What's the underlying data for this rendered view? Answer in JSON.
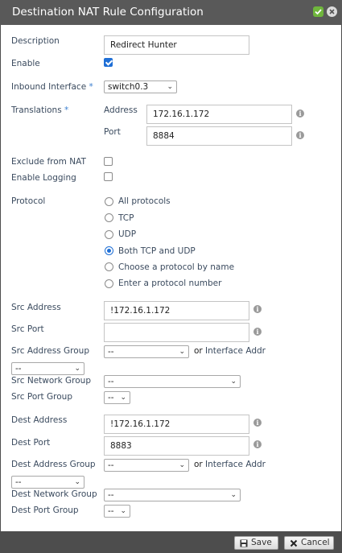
{
  "title": "Destination NAT Rule Configuration",
  "fields": {
    "description": {
      "label": "Description",
      "value": "Redirect Hunter"
    },
    "enable": {
      "label": "Enable",
      "checked": true
    },
    "inbound": {
      "label": "Inbound Interface",
      "required": "*",
      "value": "switch0.3"
    },
    "translations": {
      "label": "Translations",
      "required": "*",
      "address_label": "Address",
      "address_value": "172.16.1.172",
      "port_label": "Port",
      "port_value": "8884"
    },
    "exclude": {
      "label": "Exclude from NAT",
      "checked": false
    },
    "logging": {
      "label": "Enable Logging",
      "checked": false
    },
    "protocol": {
      "label": "Protocol",
      "options": [
        "All protocols",
        "TCP",
        "UDP",
        "Both TCP and UDP",
        "Choose a protocol by name",
        "Enter a protocol number"
      ],
      "selected": "Both TCP and UDP"
    },
    "src_address": {
      "label": "Src Address",
      "value": "!172.16.1.172"
    },
    "src_port": {
      "label": "Src Port",
      "value": ""
    },
    "src_address_group": {
      "label": "Src Address Group",
      "value": "--",
      "or": "or",
      "interface_addr": "Interface Addr",
      "extra_value": "--"
    },
    "src_network_group": {
      "label": "Src Network Group",
      "value": "--"
    },
    "src_port_group": {
      "label": "Src Port Group",
      "value": "--"
    },
    "dest_address": {
      "label": "Dest Address",
      "value": "!172.16.1.172"
    },
    "dest_port": {
      "label": "Dest Port",
      "value": "8883"
    },
    "dest_address_group": {
      "label": "Dest Address Group",
      "value": "--",
      "or": "or",
      "interface_addr": "Interface Addr",
      "extra_value": "--"
    },
    "dest_network_group": {
      "label": "Dest Network Group",
      "value": "--"
    },
    "dest_port_group": {
      "label": "Dest Port Group",
      "value": "--"
    }
  },
  "footer": {
    "save": "Save",
    "cancel": "Cancel"
  },
  "icons": {
    "save": "floppy-icon",
    "cancel": "x-icon",
    "info": "info-icon",
    "confirm": "check-icon",
    "close": "close-icon"
  },
  "colors": {
    "accent": "#1f6fd6",
    "titlebar": "#595959",
    "required": "#3b7fd0"
  }
}
